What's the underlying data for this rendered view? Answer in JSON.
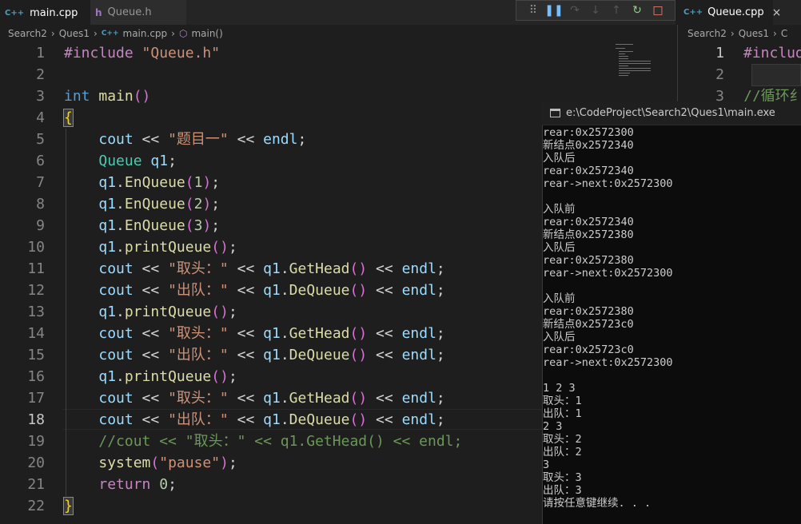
{
  "tabs": [
    {
      "icon": "C++",
      "label": "main.cpp",
      "close": "×"
    },
    {
      "icon": "h",
      "label": "Queue.h"
    }
  ],
  "breadcrumb": [
    "Search2",
    "Ques1",
    "main.cpp",
    "main()"
  ],
  "gutter": [
    "1",
    "2",
    "3",
    "4",
    "5",
    "6",
    "7",
    "8",
    "9",
    "10",
    "11",
    "12",
    "13",
    "14",
    "15",
    "16",
    "17",
    "18",
    "19",
    "20",
    "21",
    "22"
  ],
  "code": {
    "l1": {
      "directive": "#include",
      "header": "\"Queue.h\""
    },
    "l3": {
      "type": "int",
      "name": "main",
      "parens": "()"
    },
    "l4": {
      "brace": "{"
    },
    "l5": {
      "a": "cout",
      "op1": " << ",
      "s": "\"题目一\"",
      "op2": " << ",
      "b": "endl",
      "end": ";"
    },
    "l6": {
      "type": "Queue",
      "var": "q1",
      "end": ";"
    },
    "l7": {
      "obj": "q1",
      "dot": ".",
      "fn": "EnQueue",
      "open": "(",
      "arg": "1",
      "close": ")",
      "end": ";"
    },
    "l8": {
      "obj": "q1",
      "dot": ".",
      "fn": "EnQueue",
      "open": "(",
      "arg": "2",
      "close": ")",
      "end": ";"
    },
    "l9": {
      "obj": "q1",
      "dot": ".",
      "fn": "EnQueue",
      "open": "(",
      "arg": "3",
      "close": ")",
      "end": ";"
    },
    "l10": {
      "obj": "q1",
      "dot": ".",
      "fn": "printQueue",
      "parens": "()",
      "end": ";"
    },
    "l11": {
      "a": "cout",
      "op1": " << ",
      "s": "\"取头：\"",
      "op2": " << ",
      "obj": "q1",
      "dot": ".",
      "fn": "GetHead",
      "parens": "()",
      "op3": " << ",
      "b": "endl",
      "end": ";"
    },
    "l12": {
      "a": "cout",
      "op1": " << ",
      "s": "\"出队：\"",
      "op2": " << ",
      "obj": "q1",
      "dot": ".",
      "fn": "DeQueue",
      "parens": "()",
      "op3": " << ",
      "b": "endl",
      "end": ";"
    },
    "l13": {
      "obj": "q1",
      "dot": ".",
      "fn": "printQueue",
      "parens": "()",
      "end": ";"
    },
    "l14": {
      "a": "cout",
      "op1": " << ",
      "s": "\"取头：\"",
      "op2": " << ",
      "obj": "q1",
      "dot": ".",
      "fn": "GetHead",
      "parens": "()",
      "op3": " << ",
      "b": "endl",
      "end": ";"
    },
    "l15": {
      "a": "cout",
      "op1": " << ",
      "s": "\"出队：\"",
      "op2": " << ",
      "obj": "q1",
      "dot": ".",
      "fn": "DeQueue",
      "parens": "()",
      "op3": " << ",
      "b": "endl",
      "end": ";"
    },
    "l16": {
      "obj": "q1",
      "dot": ".",
      "fn": "printQueue",
      "parens": "()",
      "end": ";"
    },
    "l17": {
      "a": "cout",
      "op1": " << ",
      "s": "\"取头：\"",
      "op2": " << ",
      "obj": "q1",
      "dot": ".",
      "fn": "GetHead",
      "parens": "()",
      "op3": " << ",
      "b": "endl",
      "end": ";"
    },
    "l18": {
      "a": "cout",
      "op1": " << ",
      "s": "\"出队：\"",
      "op2": " << ",
      "obj": "q1",
      "dot": ".",
      "fn": "DeQueue",
      "parens": "()",
      "op3": " << ",
      "b": "endl",
      "end": ";"
    },
    "l19": {
      "comment": "//cout << \"取头：\" << q1.GetHead() << endl;"
    },
    "l20": {
      "fn": "system",
      "open": "(",
      "s": "\"pause\"",
      "close": ")",
      "end": ";"
    },
    "l21": {
      "kw": "return",
      "num": "0",
      "end": ";"
    },
    "l22": {
      "brace": "}"
    }
  },
  "right_pane": {
    "tab": {
      "icon": "C++",
      "label": "Queue.cpp",
      "close": "×"
    },
    "breadcrumb": [
      "Search2",
      "Ques1",
      "C"
    ],
    "lines": [
      "1",
      "2",
      "3"
    ],
    "code1": "#includ",
    "code3": "//循环纟"
  },
  "console": {
    "title": "e:\\CodeProject\\Search2\\Ques1\\main.exe",
    "lines": [
      "rear:0x2572300",
      "新结点0x2572340",
      "入队后",
      "rear:0x2572340",
      "rear->next:0x2572300",
      "",
      "入队前",
      "rear:0x2572340",
      "新结点0x2572380",
      "入队后",
      "rear:0x2572380",
      "rear->next:0x2572300",
      "",
      "入队前",
      "rear:0x2572380",
      "新结点0x25723c0",
      "入队后",
      "rear:0x25723c0",
      "rear->next:0x2572300",
      "",
      "1 2 3",
      "取头：1",
      "出队：1",
      "2 3",
      "取头：2",
      "出队：2",
      "3",
      "取头：3",
      "出队：3",
      "请按任意键继续. . ."
    ]
  },
  "colors": {
    "editor_bg": "#1e1e1e",
    "keyword": "#569cd6",
    "function": "#dcdcaa",
    "string": "#ce9178",
    "type": "#4ec9b0",
    "comment": "#6a9955",
    "console_bg": "#0c0c0c"
  }
}
